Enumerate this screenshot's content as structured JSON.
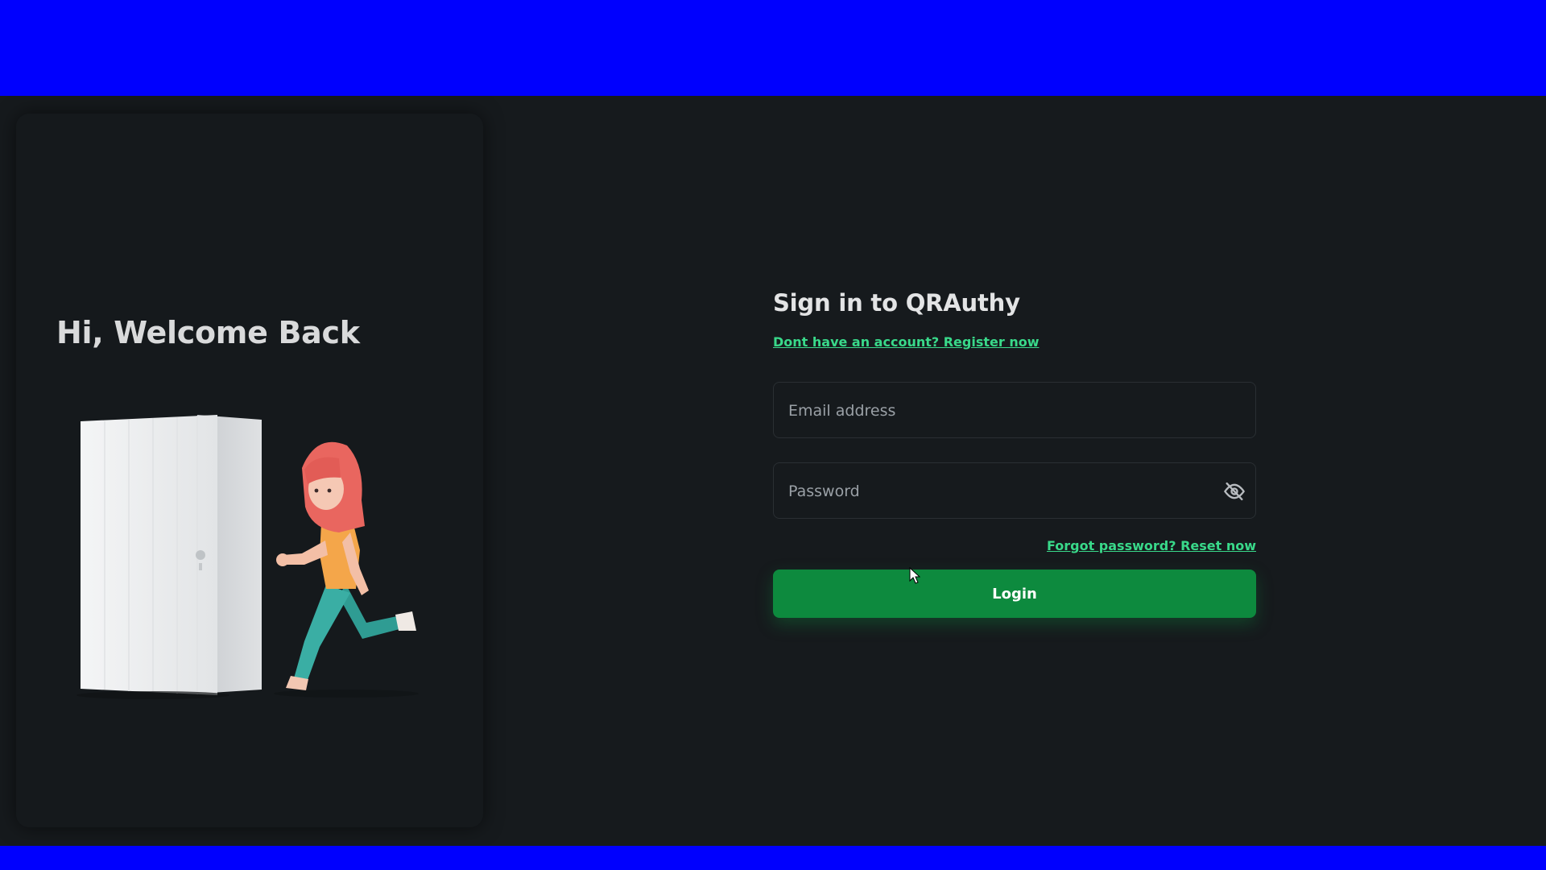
{
  "left_panel": {
    "heading": "Hi, Welcome Back"
  },
  "form": {
    "title": "Sign in to QRAuthy",
    "register_link": "Dont have an account? Register now",
    "email": {
      "placeholder": "Email address",
      "value": ""
    },
    "password": {
      "placeholder": "Password",
      "value": "",
      "toggle_icon": "eye-off-icon"
    },
    "forgot_link": "Forgot password? Reset now",
    "login_label": "Login"
  },
  "colors": {
    "background": "#161a1d",
    "band": "#0000fe",
    "accent": "#39d98a",
    "button": "#0d8a3e"
  }
}
